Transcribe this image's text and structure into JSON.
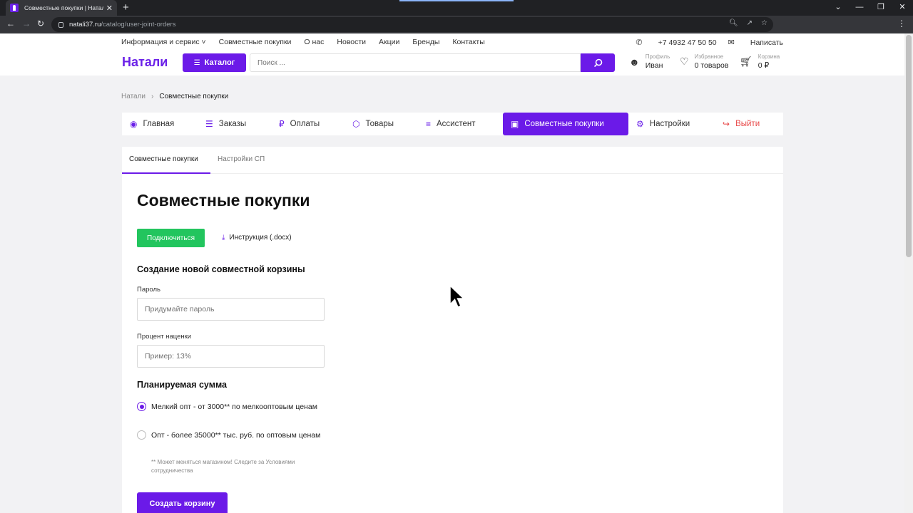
{
  "browser": {
    "tab_title": "Совместные покупки | Натали I",
    "tab_close": "✕",
    "new_tab": "+",
    "url_domain": "natali37.ru",
    "url_path": "/catalog/user-joint-orders"
  },
  "site": {
    "top_nav": [
      "Информация и сервис ˅",
      "Совместные покупки",
      "О нас",
      "Новости",
      "Акции",
      "Бренды",
      "Контакты"
    ],
    "phone": "+7 4932 47 50 50",
    "write": "Написать",
    "logo": "Натали",
    "catalog_label": "Каталог",
    "search_placeholder": "Поиск ...",
    "profile_caption": "Профиль",
    "profile_name": "Иван",
    "favorites_caption": "Избранное",
    "favorites_value": "0 товаров",
    "cart_caption": "Корзина",
    "cart_value": "0 ₽"
  },
  "breadcrumb": {
    "home": "Натали",
    "separator": "›",
    "current": "Совместные покупки"
  },
  "account_tabs": {
    "home": "Главная",
    "orders": "Заказы",
    "payments": "Оплаты",
    "products": "Товары",
    "assistant": "Ассистент",
    "joint": "Совместные покупки",
    "settings": "Настройки",
    "logout": "Выйти"
  },
  "subtabs": {
    "joint": "Совместные покупки",
    "settings": "Настройки СП"
  },
  "main": {
    "title": "Совместные покупки",
    "connect_label": "Подключиться",
    "doc_label": "Инструкция (.docx)",
    "create_section": "Создание новой совместной корзины",
    "password_label": "Пароль",
    "password_placeholder": "Придумайте пароль",
    "markup_label": "Процент наценки",
    "markup_placeholder": "Пример: 13%",
    "planned_section": "Планируемая сумма",
    "option_small": "Мелкий опт - от 3000** по мелкооптовым ценам",
    "option_wholesale": "Опт - более 35000** тыс. руб. по оптовым ценам",
    "footnote": "** Может меняться магазином! Следите за Условиями сотрудничества",
    "create_label": "Создать корзину"
  },
  "colors": {
    "brand": "#6b1ae8",
    "success": "#22c55e",
    "danger": "#e84848"
  }
}
